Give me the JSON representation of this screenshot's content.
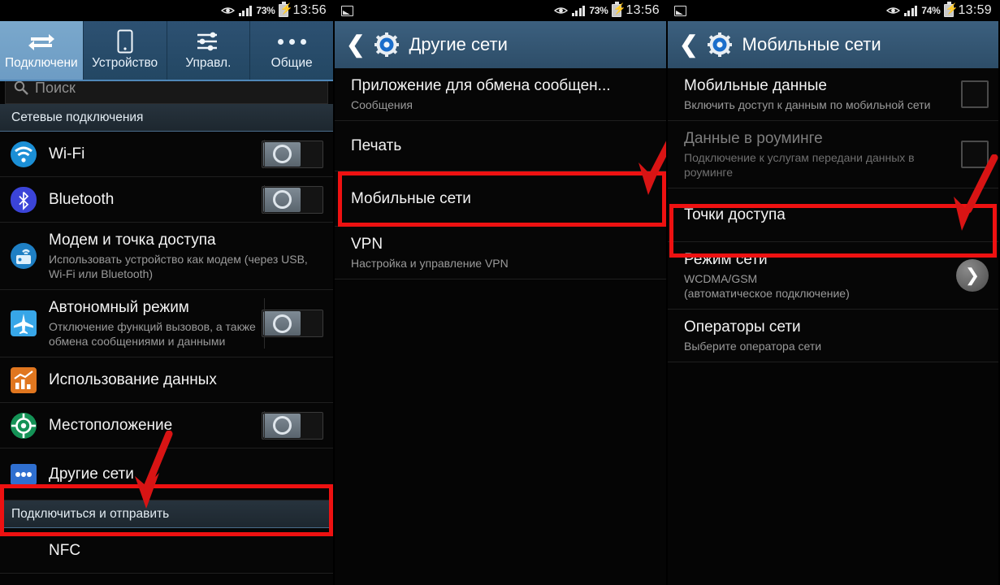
{
  "panels": [
    {
      "id": "connections",
      "statusbar": {
        "battery": "73%",
        "time": "13:56",
        "icons": [
          "eye-icon",
          "signal-icon",
          "battery-charging-icon"
        ]
      },
      "tabs": [
        {
          "label": "Подключени",
          "icon": "transfer-arrows-icon",
          "active": true
        },
        {
          "label": "Устройство",
          "icon": "phone-icon",
          "active": false
        },
        {
          "label": "Управл.",
          "icon": "sliders-icon",
          "active": false
        },
        {
          "label": "Общие",
          "icon": "more-dots-icon",
          "active": false
        }
      ],
      "search": {
        "placeholder": "Поиск",
        "icon": "search-icon"
      },
      "section_title": "Сетевые подключения",
      "section_title_2": "Подключиться и отправить",
      "items": [
        {
          "title": "Wi-Fi",
          "subtitle": "",
          "icon": "wifi-icon",
          "control": "toggle"
        },
        {
          "title": "Bluetooth",
          "subtitle": "",
          "icon": "bluetooth-icon",
          "control": "toggle"
        },
        {
          "title": "Модем и точка доступа",
          "subtitle": "Использовать устройство как модем (через USB, Wi-Fi или Bluetooth)",
          "icon": "tethering-icon",
          "control": "none"
        },
        {
          "title": "Автономный режим",
          "subtitle": "Отключение функций вызовов, а также обмена сообщениями и данными",
          "icon": "airplane-icon",
          "control": "toggle"
        },
        {
          "title": "Использование данных",
          "subtitle": "",
          "icon": "data-usage-icon",
          "control": "none"
        },
        {
          "title": "Местоположение",
          "subtitle": "",
          "icon": "location-icon",
          "control": "toggle"
        },
        {
          "title": "Другие сети",
          "subtitle": "",
          "icon": "other-networks-icon",
          "control": "none",
          "highlighted": true
        },
        {
          "title": "NFC",
          "subtitle": "",
          "icon": "nfc-icon",
          "control": "none"
        }
      ]
    },
    {
      "id": "other-networks",
      "statusbar": {
        "battery": "73%",
        "time": "13:56",
        "icons": [
          "screenshot-icon",
          "eye-icon",
          "signal-icon",
          "battery-charging-icon"
        ]
      },
      "header": {
        "title": "Другие сети",
        "back_icon": "back-chevron-icon",
        "app_icon": "settings-gear-icon"
      },
      "items": [
        {
          "title": "Приложение для обмена сообщен...",
          "subtitle": "Сообщения",
          "control": "none"
        },
        {
          "title": "Печать",
          "subtitle": "",
          "control": "none"
        },
        {
          "title": "Мобильные сети",
          "subtitle": "",
          "control": "none",
          "highlighted": true
        },
        {
          "title": "VPN",
          "subtitle": "Настройка и управление VPN",
          "control": "none"
        }
      ]
    },
    {
      "id": "mobile-networks",
      "statusbar": {
        "battery": "74%",
        "time": "13:59",
        "icons": [
          "screenshot-icon",
          "eye-icon",
          "signal-icon",
          "battery-charging-icon"
        ]
      },
      "header": {
        "title": "Мобильные сети",
        "back_icon": "back-chevron-icon",
        "app_icon": "settings-gear-icon"
      },
      "items": [
        {
          "title": "Мобильные данные",
          "subtitle": "Включить доступ к данным по мобильной сети",
          "control": "checkbox",
          "dim": false
        },
        {
          "title": "Данные в роуминге",
          "subtitle": "Подключение к услугам передани данных в роуминге",
          "control": "checkbox",
          "dim": true
        },
        {
          "title": "Точки доступа",
          "subtitle": "",
          "control": "none",
          "highlighted": true
        },
        {
          "title": "Режим сети",
          "subtitle": "WCDMA/GSM\n(автоматическое подключение)",
          "control": "chevron"
        },
        {
          "title": "Операторы сети",
          "subtitle": "Выберите оператора сети",
          "control": "none"
        }
      ]
    }
  ],
  "annotation": {
    "highlight_color": "#ee1111",
    "arrow_color": "#d81414"
  }
}
